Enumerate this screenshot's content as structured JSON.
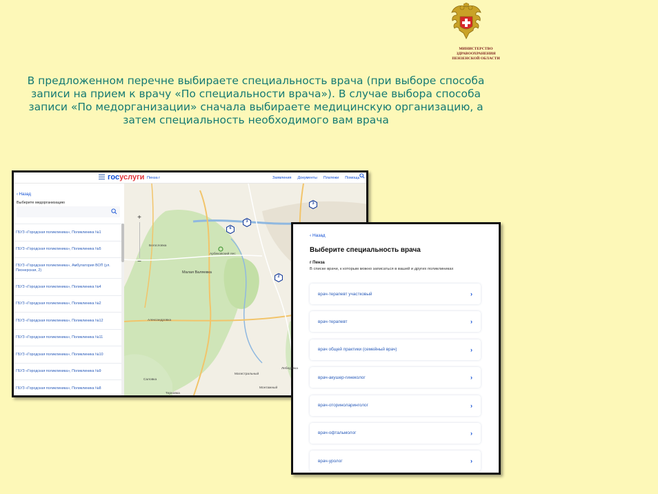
{
  "header": {
    "ministry_lines": [
      "МИНИСТЕРСТВО",
      "ЗДРАВООХРАНЕНИЯ",
      "ПЕНЗЕНСКОЙ ОБЛАСТИ"
    ]
  },
  "instruction": {
    "text": "В предложенном перечне выбираете специальность врача (при выборе способа записи на прием к врачу «По специальности врача»). В случае выбора способа записи «По медорганизации» сначала выбираете медицинскую организацию, а затем специальность необходимого вам врача"
  },
  "portal": {
    "logo_part1": "гос",
    "logo_part2": "услуги",
    "city": "Пенза г",
    "nav": [
      "Заявления",
      "Документы",
      "Платежи",
      "Помощь"
    ],
    "back": "‹ Назад",
    "select_title": "Выберите медорганизацию",
    "search_placeholder": "",
    "orgs": [
      "ГБУЗ «Городская поликлиника», Поликлиника №1",
      "ГБУЗ «Городская поликлиника», Поликлиника №5",
      "ГБУЗ «Городская поликлиника», Амбулатория ВОП (ул. Пионерская, 2)",
      "ГБУЗ «Городская поликлиника», Поликлиника №4",
      "ГБУЗ «Городская поликлиника», Поликлиника №2",
      "ГБУЗ «Городская поликлиника», Поликлиника №12",
      "ГБУЗ «Городская поликлиника», Поликлиника №11",
      "ГБУЗ «Городская поликлиника», Поликлиника №10",
      "ГБУЗ «Городская поликлиника», Поликлиника №9",
      "ГБУЗ «Городская поликлиника», Поликлиника №8"
    ],
    "map": {
      "zoom_in": "+",
      "zoom_out": "−",
      "pins": [
        "6",
        "3",
        "3",
        "2"
      ],
      "labels": [
        "Богословка",
        "Малая Валяевка",
        "Арбековский лес",
        "Александровка",
        "Саловка",
        "Магистральный",
        "Монтажный",
        "Лебедевка",
        "Терновка"
      ]
    }
  },
  "specialty_page": {
    "back": "‹ Назад",
    "title": "Выберите специальность врача",
    "city": "г Пенза",
    "hint": "В списке врачи, к которым можно записаться в вашей и других поликлиниках",
    "chevron": "›",
    "items": [
      "врач-терапевт участковый",
      "врач-терапевт",
      "врач общей практики (семейный врач)",
      "врач-акушер-гинеколог",
      "врач-оториноларинголог",
      "врач-офтальмолог",
      "врач-уролог"
    ]
  }
}
